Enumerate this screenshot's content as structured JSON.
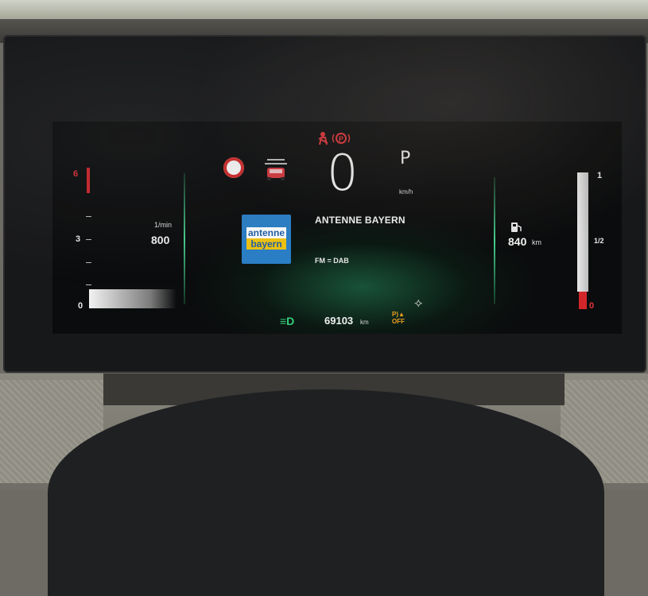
{
  "tachometer": {
    "scale_labels": [
      "6",
      "3",
      "0"
    ],
    "unit": "1/min",
    "value": "800"
  },
  "speedometer": {
    "value": "0",
    "unit": "km/h",
    "gear": "P"
  },
  "radio": {
    "station_name": "ANTENNE BAYERN",
    "logo_line1": "antenne",
    "logo_line2": "bayern",
    "band": "FM = DAB"
  },
  "fuel": {
    "range_value": "840",
    "range_unit": "km",
    "scale_labels": [
      "1",
      "1/2",
      "0"
    ]
  },
  "odometer": {
    "value": "69103",
    "unit": "km"
  },
  "warnings": {
    "park_assist_label": "OFF",
    "seatbelt_color": "#e2333a",
    "headlight_color": "#34d07a"
  },
  "icons": [
    "speed-limit-sign-icon",
    "adaptive-cruise-car-icon",
    "seatbelt-warning-icon",
    "parking-brake-icon",
    "low-beam-headlight-icon",
    "park-assist-off-icon",
    "gps-icon",
    "fuel-pump-icon"
  ]
}
